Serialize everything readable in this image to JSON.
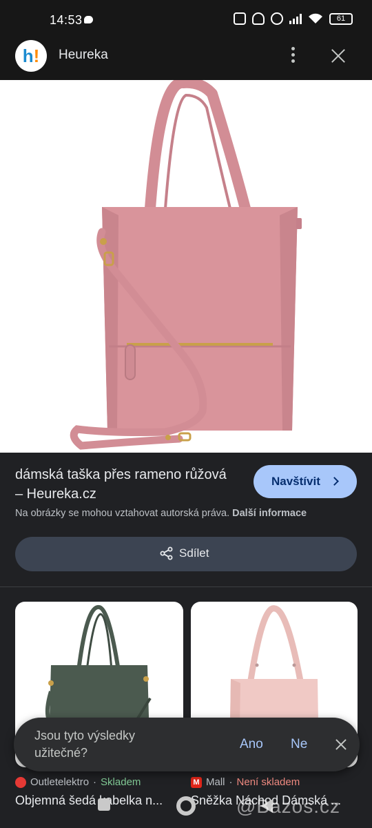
{
  "status_bar": {
    "time": "14:53",
    "battery": "61"
  },
  "header": {
    "logo_text_h": "h",
    "logo_text_ex": "!",
    "title": "Heureka"
  },
  "result": {
    "title": "dámská taška přes rameno růžová – Heureka.cz",
    "visit_label": "Navštívit",
    "copyright_text": "Na obrázky se mohou vztahovat autorská práva.",
    "more_info_label": "Další informace",
    "share_label": "Sdílet"
  },
  "related": [
    {
      "source": "Outletelektro",
      "separator": "·",
      "availability": "Skladem",
      "availability_status": "in-stock",
      "title": "Objemná šedá kabelka n..."
    },
    {
      "source": "Mall",
      "source_icon_letter": "M",
      "separator": "·",
      "availability": "Není skladem",
      "availability_status": "out-of-stock",
      "title": "Sněžka Náchod Dámská ..."
    }
  ],
  "feedback": {
    "question": "Jsou tyto výsledky užitečné?",
    "yes_label": "Ano",
    "no_label": "Ne"
  },
  "watermark": "@Bazos.cz",
  "colors": {
    "accent": "#a8c7fa",
    "bag_pink": "#d9949b",
    "bag_grey": "#4b5a4f",
    "bag_light_pink": "#f0c9c5",
    "in_stock": "#81c995",
    "out_of_stock": "#f28b82"
  }
}
